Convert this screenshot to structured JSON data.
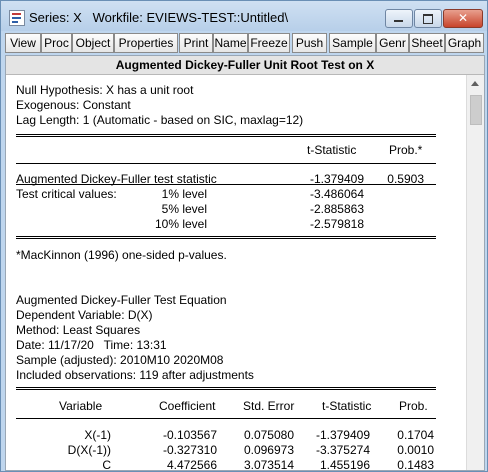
{
  "window": {
    "title": "Series: X   Workfile: EVIEWS-TEST::Untitled\\",
    "close_glyph": "✕"
  },
  "toolbar": [
    "View",
    "Proc",
    "Object",
    "Properties",
    "Print",
    "Name",
    "Freeze",
    "Push",
    "Sample",
    "Genr",
    "Sheet",
    "Graph"
  ],
  "output": {
    "header": "Augmented Dickey-Fuller Unit Root Test on X",
    "null_hypothesis": "Null Hypothesis: X has a unit root",
    "exogenous": "Exogenous: Constant",
    "lag_length": "Lag Length: 1 (Automatic - based on SIC, maxlag=12)",
    "col_tstat": "t-Statistic",
    "col_prob": "Prob.*",
    "adf_label": "Augmented Dickey-Fuller test statistic",
    "adf_tstat": "-1.379409",
    "adf_prob": "0.5903",
    "critical_label": "Test critical values:",
    "critical": [
      {
        "level": "1% level",
        "value": "-3.486064"
      },
      {
        "level": "5% level",
        "value": "-2.885863"
      },
      {
        "level": "10% level",
        "value": "-2.579818"
      }
    ],
    "footnote": "*MacKinnon (1996) one-sided p-values.",
    "eq_title": "Augmented Dickey-Fuller Test Equation",
    "dep_var": "Dependent Variable: D(X)",
    "method": "Method: Least Squares",
    "date": "Date: 11/17/20   Time: 13:31",
    "sample": "Sample (adjusted): 2010M10 2020M08",
    "obs": "Included observations: 119 after adjustments",
    "reg_headers": {
      "variable": "Variable",
      "coefficient": "Coefficient",
      "std_error": "Std. Error",
      "t_stat": "t-Statistic",
      "prob": "Prob."
    },
    "reg_rows": [
      {
        "variable": "X(-1)",
        "coefficient": "-0.103567",
        "std_error": "0.075080",
        "t_stat": "-1.379409",
        "prob": "0.1704"
      },
      {
        "variable": "D(X(-1))",
        "coefficient": "-0.327310",
        "std_error": "0.096973",
        "t_stat": "-3.375274",
        "prob": "0.0010"
      },
      {
        "variable": "C",
        "coefficient": "4.472566",
        "std_error": "3.073514",
        "t_stat": "1.455196",
        "prob": "0.1483"
      }
    ]
  }
}
